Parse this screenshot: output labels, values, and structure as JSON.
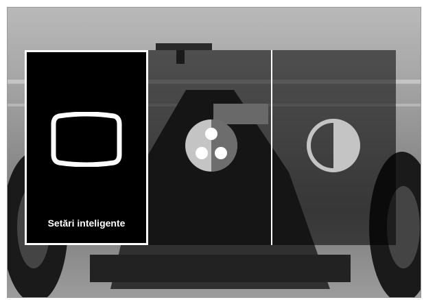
{
  "menu": {
    "selected_index": 0,
    "items": [
      {
        "label": "Setări inteligente",
        "icon": "screen-icon"
      },
      {
        "label": "",
        "icon": "color-dots-icon"
      },
      {
        "label": "",
        "icon": "contrast-icon"
      }
    ]
  },
  "colors": {
    "overlay": "#000000",
    "selection_border": "#ffffff",
    "icon_selected": "#ffffff",
    "icon_unselected": "#c4c4c4"
  }
}
